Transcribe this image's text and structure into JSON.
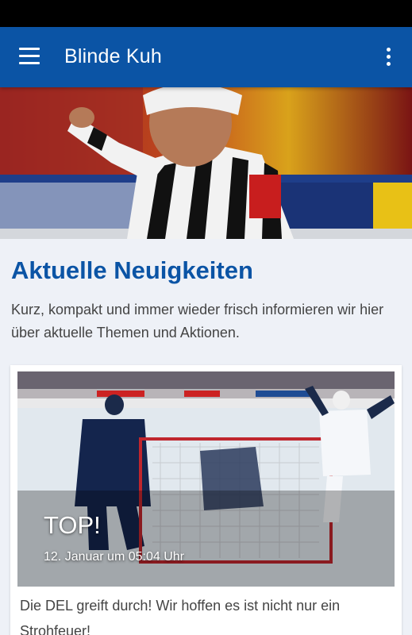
{
  "app_bar": {
    "title": "Blinde Kuh",
    "menu_icon": "hamburger-menu-icon",
    "overflow_icon": "more-vertical-icon",
    "color": "#0b54a5"
  },
  "hero": {
    "image": "ice-hockey-referee-photo"
  },
  "section": {
    "title": "Aktuelle Neuigkeiten",
    "intro": "Kurz, kompakt und immer wieder frisch informieren wir hier über aktuelle Themen und Aktionen."
  },
  "news": [
    {
      "title": "TOP!",
      "date": "12. Januar um 05:04 Uhr",
      "text": "Die DEL greift durch! Wir hoffen es ist nicht nur ein Strohfeuer!",
      "image": "ice-hockey-goal-celebration-photo"
    }
  ]
}
